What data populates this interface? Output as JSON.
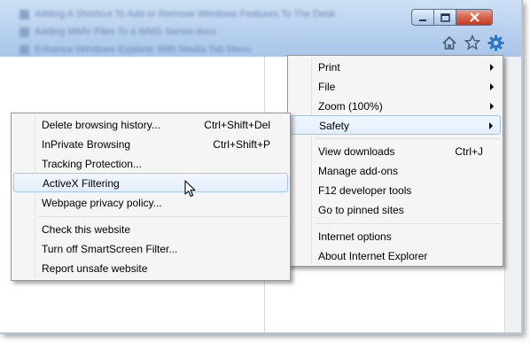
{
  "window": {
    "controls": {
      "minimize": "minimize",
      "maximize": "maximize",
      "close": "close"
    }
  },
  "toolbar_icons": [
    "home-icon",
    "favorites-star-icon",
    "tools-gear-icon"
  ],
  "main_menu": {
    "items": [
      {
        "label": "Print",
        "shortcut": "",
        "submenu": true
      },
      {
        "label": "File",
        "shortcut": "",
        "submenu": true
      },
      {
        "label": "Zoom (100%)",
        "shortcut": "",
        "submenu": true
      },
      {
        "label": "Safety",
        "shortcut": "",
        "submenu": true,
        "highlighted": true
      },
      {
        "label": "View downloads",
        "shortcut": "Ctrl+J"
      },
      {
        "label": "Manage add-ons",
        "shortcut": ""
      },
      {
        "label": "F12 developer tools",
        "shortcut": ""
      },
      {
        "label": "Go to pinned sites",
        "shortcut": ""
      },
      {
        "label": "Internet options",
        "shortcut": ""
      },
      {
        "label": "About Internet Explorer",
        "shortcut": ""
      }
    ]
  },
  "safety_menu": {
    "items": [
      {
        "label": "Delete browsing history...",
        "shortcut": "Ctrl+Shift+Del"
      },
      {
        "label": "InPrivate Browsing",
        "shortcut": "Ctrl+Shift+P"
      },
      {
        "label": "Tracking Protection...",
        "shortcut": ""
      },
      {
        "label": "ActiveX Filtering",
        "shortcut": "",
        "highlighted": true
      },
      {
        "label": "Webpage privacy policy...",
        "shortcut": ""
      },
      {
        "label": "Check this website",
        "shortcut": ""
      },
      {
        "label": "Turn off SmartScreen Filter...",
        "shortcut": ""
      },
      {
        "label": "Report unsafe website",
        "shortcut": ""
      }
    ]
  },
  "colors": {
    "titlebar": "#bcd3ef",
    "menu_background": "#f5f5f5",
    "highlight_border": "#a8c4e6",
    "gear_icon": "#2c78c8"
  }
}
